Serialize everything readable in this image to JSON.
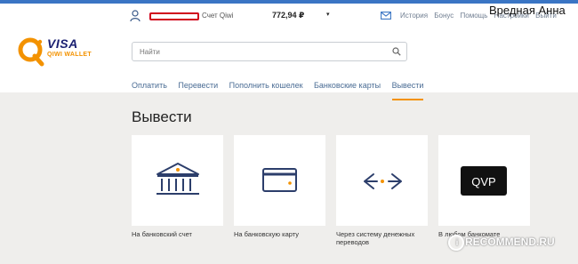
{
  "header": {
    "account_label": "Счет Qiwi",
    "balance": "772,94 ₽",
    "balance_caret": "▾",
    "top_links": [
      "История",
      "Бонус",
      "Помощь",
      "Настройки",
      "Выйти"
    ],
    "username": "Вредная Анна"
  },
  "logo": {
    "visa": "VISA",
    "qiwi": "QIWI WALLET"
  },
  "search": {
    "placeholder": "Найти"
  },
  "nav": {
    "items": [
      "Оплатить",
      "Перевести",
      "Пополнить кошелек",
      "Банковские карты",
      "Вывести"
    ],
    "active_index": 4
  },
  "page": {
    "title": "Вывести"
  },
  "cards": [
    {
      "label": "На банковский счет",
      "icon": "bank-icon"
    },
    {
      "label": "На банковскую карту",
      "icon": "bank-card-icon"
    },
    {
      "label": "Через систему денежных переводов",
      "icon": "money-transfer-arrows-icon"
    },
    {
      "label": "В любом банкомате",
      "icon": "qvp-icon",
      "icon_text": "QVP"
    }
  ],
  "watermark": {
    "text": "RECOMMEND.RU",
    "badge": "i"
  },
  "colors": {
    "accent": "#f39200",
    "nav_text": "#4a6c94",
    "icon_stroke": "#2c3e6b",
    "top_strip": "#3a75c4"
  }
}
